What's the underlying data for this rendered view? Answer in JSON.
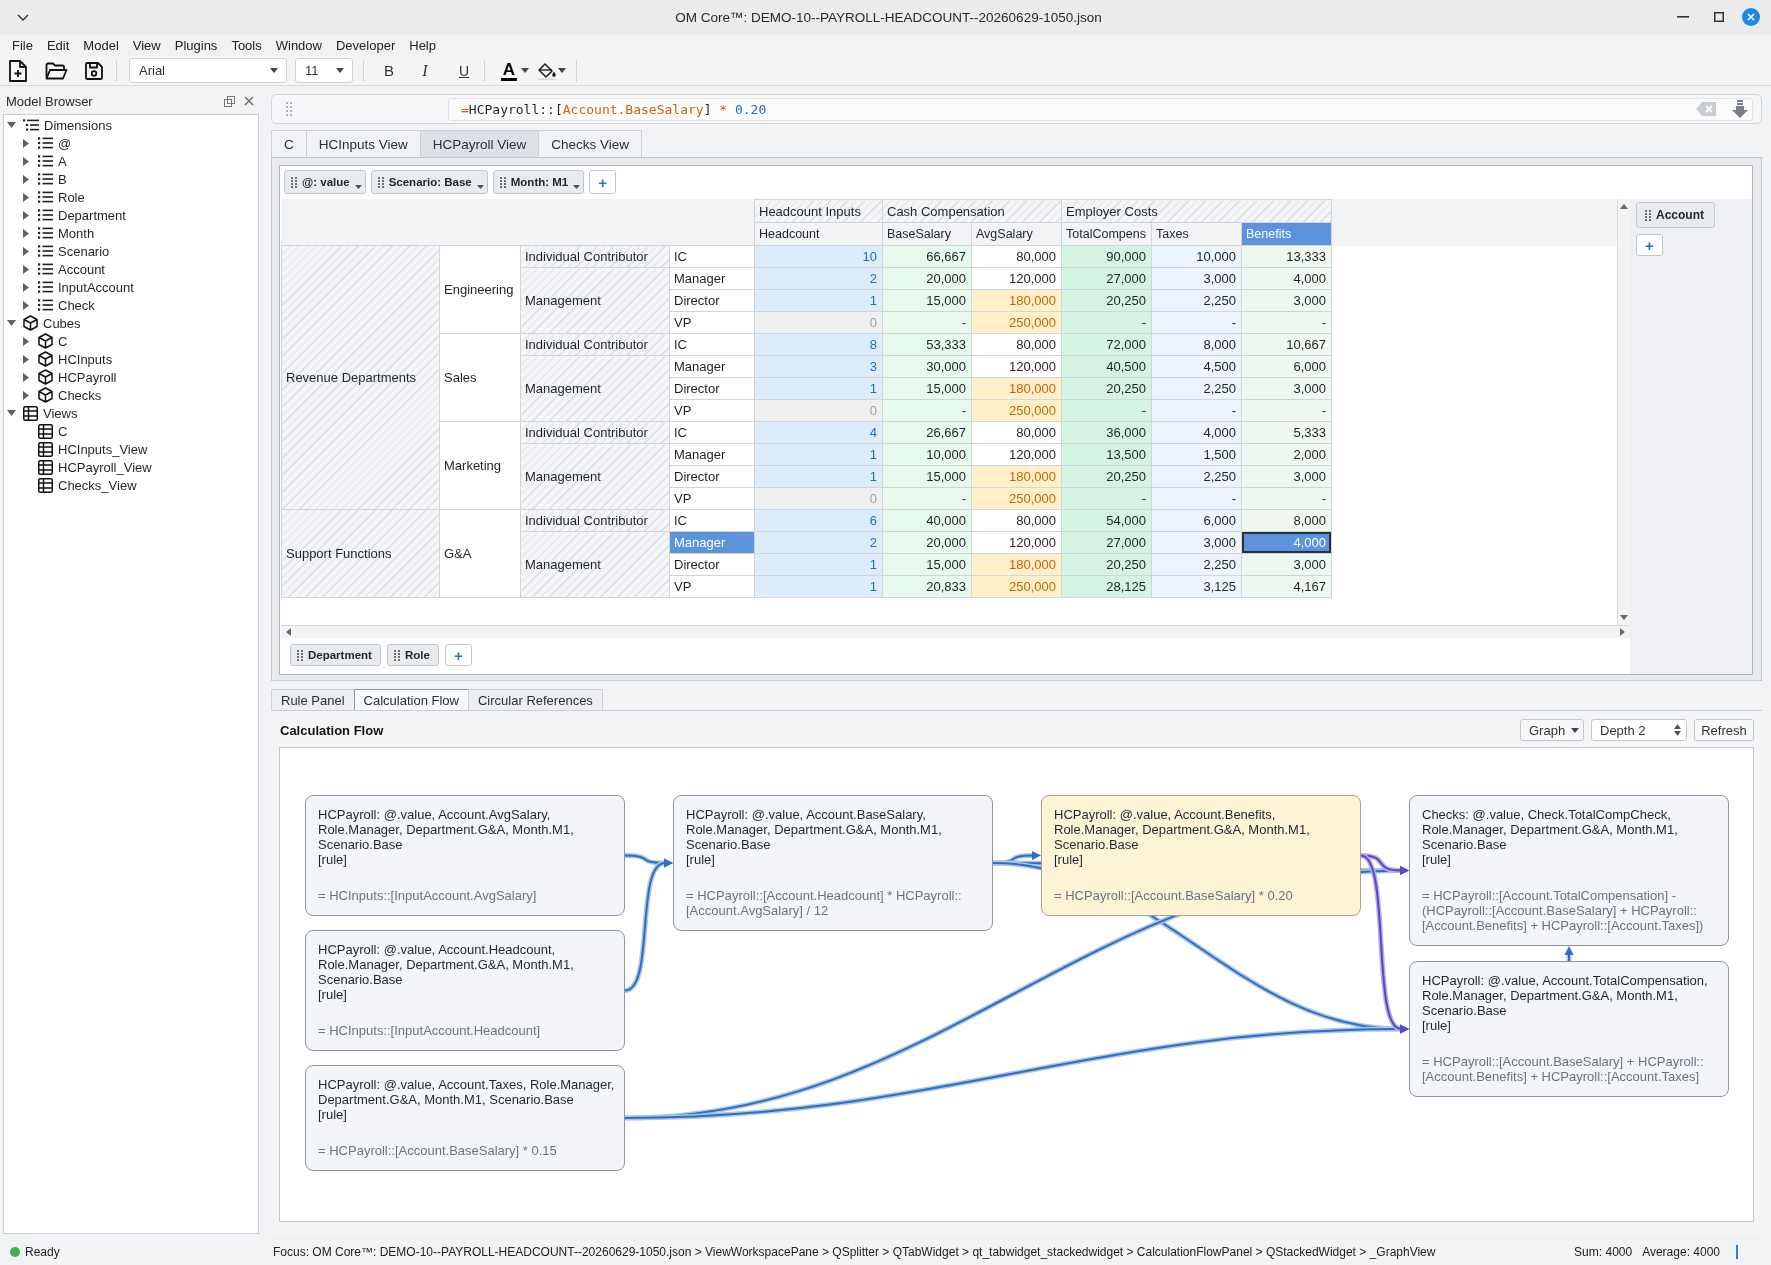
{
  "window": {
    "title": "OM Core™: DEMO-10--PAYROLL-HEADCOUNT--20260629-1050.json"
  },
  "menu": [
    "File",
    "Edit",
    "Model",
    "View",
    "Plugins",
    "Tools",
    "Window",
    "Developer",
    "Help"
  ],
  "toolbar": {
    "font": "Arial",
    "size": "11",
    "bold": "B",
    "italic": "I",
    "underline": "U",
    "text_color": "A"
  },
  "sidebar": {
    "title": "Model Browser",
    "items": [
      {
        "label": "Dimensions",
        "kind": "dimension_group",
        "expanded": true,
        "children": [
          {
            "label": "@",
            "kind": "dimension",
            "expanded": false
          },
          {
            "label": "A",
            "kind": "dimension",
            "expanded": false
          },
          {
            "label": "B",
            "kind": "dimension",
            "expanded": false
          },
          {
            "label": "Role",
            "kind": "dimension",
            "expanded": false
          },
          {
            "label": "Department",
            "kind": "dimension",
            "expanded": false
          },
          {
            "label": "Month",
            "kind": "dimension",
            "expanded": false
          },
          {
            "label": "Scenario",
            "kind": "dimension",
            "expanded": false
          },
          {
            "label": "Account",
            "kind": "dimension",
            "expanded": false
          },
          {
            "label": "InputAccount",
            "kind": "dimension",
            "expanded": false
          },
          {
            "label": "Check",
            "kind": "dimension",
            "expanded": false
          }
        ]
      },
      {
        "label": "Cubes",
        "kind": "cube",
        "expanded": true,
        "children": [
          {
            "label": "C",
            "kind": "cube",
            "expanded": false
          },
          {
            "label": "HCInputs",
            "kind": "cube",
            "expanded": false
          },
          {
            "label": "HCPayroll",
            "kind": "cube",
            "expanded": false
          },
          {
            "label": "Checks",
            "kind": "cube",
            "expanded": false
          }
        ]
      },
      {
        "label": "Views",
        "kind": "view",
        "expanded": true,
        "children": [
          {
            "label": "C",
            "kind": "view"
          },
          {
            "label": "HCInputs_View",
            "kind": "view"
          },
          {
            "label": "HCPayroll_View",
            "kind": "view"
          },
          {
            "label": "Checks_View",
            "kind": "view"
          }
        ]
      }
    ]
  },
  "formula_bar": {
    "tokens": [
      {
        "text": "=",
        "kind": "operator"
      },
      {
        "text": "HCPayroll::[",
        "kind": "plain"
      },
      {
        "text": "Account.BaseSalary",
        "kind": "reference"
      },
      {
        "text": "] ",
        "kind": "plain"
      },
      {
        "text": "* ",
        "kind": "operator"
      },
      {
        "text": "0.20",
        "kind": "number"
      }
    ]
  },
  "view_tabs": [
    {
      "label": "C",
      "selected": false
    },
    {
      "label": "HCInputs View",
      "selected": false
    },
    {
      "label": "HCPayroll View",
      "selected": true
    },
    {
      "label": "Checks View",
      "selected": false
    }
  ],
  "pivot": {
    "filters": {
      "items": [
        "@: value",
        "Scenario: Base",
        "Month: M1"
      ],
      "add": "+"
    },
    "column_groups": [
      {
        "label": "Headcount Inputs",
        "columns": [
          {
            "label": "Headcount",
            "selected": false
          }
        ]
      },
      {
        "label": "Cash Compensation",
        "columns": [
          {
            "label": "BaseSalary",
            "selected": false
          },
          {
            "label": "AvgSalary",
            "selected": false
          }
        ]
      },
      {
        "label": "Employer Costs",
        "columns": [
          {
            "label": "TotalCompens",
            "selected": false
          },
          {
            "label": "Taxes",
            "selected": false
          },
          {
            "label": "Benefits",
            "selected": true
          }
        ]
      }
    ],
    "rows": [
      {
        "label": "Revenue Departments",
        "hatched": true,
        "children": [
          {
            "label": "Engineering",
            "hatched": false,
            "children": [
              {
                "label": "Individual Contributor",
                "hatched": true,
                "children": [
                  {
                    "label": "IC",
                    "selected": false,
                    "cells": [
                      {
                        "value": "10",
                        "kind": "input",
                        "selected": false
                      },
                      {
                        "value": "66,667",
                        "kind": "calc",
                        "selected": false
                      },
                      {
                        "value": "80,000",
                        "kind": "calc",
                        "selected": false
                      },
                      {
                        "value": "90,000",
                        "kind": "calc",
                        "selected": false
                      },
                      {
                        "value": "10,000",
                        "kind": "calc",
                        "selected": false
                      },
                      {
                        "value": "13,333",
                        "kind": "calc",
                        "selected": false
                      }
                    ]
                  }
                ]
              },
              {
                "label": "Management",
                "hatched": true,
                "children": [
                  {
                    "label": "Manager",
                    "selected": false,
                    "cells": [
                      {
                        "value": "2",
                        "kind": "input",
                        "selected": false
                      },
                      {
                        "value": "20,000",
                        "kind": "calc",
                        "selected": false
                      },
                      {
                        "value": "120,000",
                        "kind": "calc",
                        "selected": false
                      },
                      {
                        "value": "27,000",
                        "kind": "calc",
                        "selected": false
                      },
                      {
                        "value": "3,000",
                        "kind": "calc",
                        "selected": false
                      },
                      {
                        "value": "4,000",
                        "kind": "calc",
                        "selected": false
                      }
                    ]
                  },
                  {
                    "label": "Director",
                    "selected": false,
                    "cells": [
                      {
                        "value": "1",
                        "kind": "input",
                        "selected": false
                      },
                      {
                        "value": "15,000",
                        "kind": "calc",
                        "selected": false
                      },
                      {
                        "value": "180,000",
                        "kind": "flag",
                        "selected": false
                      },
                      {
                        "value": "20,250",
                        "kind": "calc",
                        "selected": false
                      },
                      {
                        "value": "2,250",
                        "kind": "calc",
                        "selected": false
                      },
                      {
                        "value": "3,000",
                        "kind": "calc",
                        "selected": false
                      }
                    ]
                  },
                  {
                    "label": "VP",
                    "selected": false,
                    "cells": [
                      {
                        "value": "0",
                        "kind": "zero",
                        "selected": false
                      },
                      {
                        "value": "-",
                        "kind": "calc",
                        "selected": false
                      },
                      {
                        "value": "250,000",
                        "kind": "flag",
                        "selected": false
                      },
                      {
                        "value": "-",
                        "kind": "calc",
                        "selected": false
                      },
                      {
                        "value": "-",
                        "kind": "calc",
                        "selected": false
                      },
                      {
                        "value": "-",
                        "kind": "calc",
                        "selected": false
                      }
                    ]
                  }
                ]
              }
            ]
          },
          {
            "label": "Sales",
            "hatched": false,
            "children": [
              {
                "label": "Individual Contributor",
                "hatched": true,
                "children": [
                  {
                    "label": "IC",
                    "selected": false,
                    "cells": [
                      {
                        "value": "8",
                        "kind": "input",
                        "selected": false
                      },
                      {
                        "value": "53,333",
                        "kind": "calc",
                        "selected": false
                      },
                      {
                        "value": "80,000",
                        "kind": "calc",
                        "selected": false
                      },
                      {
                        "value": "72,000",
                        "kind": "calc",
                        "selected": false
                      },
                      {
                        "value": "8,000",
                        "kind": "calc",
                        "selected": false
                      },
                      {
                        "value": "10,667",
                        "kind": "calc",
                        "selected": false
                      }
                    ]
                  }
                ]
              },
              {
                "label": "Management",
                "hatched": true,
                "children": [
                  {
                    "label": "Manager",
                    "selected": false,
                    "cells": [
                      {
                        "value": "3",
                        "kind": "input",
                        "selected": false
                      },
                      {
                        "value": "30,000",
                        "kind": "calc",
                        "selected": false
                      },
                      {
                        "value": "120,000",
                        "kind": "calc",
                        "selected": false
                      },
                      {
                        "value": "40,500",
                        "kind": "calc",
                        "selected": false
                      },
                      {
                        "value": "4,500",
                        "kind": "calc",
                        "selected": false
                      },
                      {
                        "value": "6,000",
                        "kind": "calc",
                        "selected": false
                      }
                    ]
                  },
                  {
                    "label": "Director",
                    "selected": false,
                    "cells": [
                      {
                        "value": "1",
                        "kind": "input",
                        "selected": false
                      },
                      {
                        "value": "15,000",
                        "kind": "calc",
                        "selected": false
                      },
                      {
                        "value": "180,000",
                        "kind": "flag",
                        "selected": false
                      },
                      {
                        "value": "20,250",
                        "kind": "calc",
                        "selected": false
                      },
                      {
                        "value": "2,250",
                        "kind": "calc",
                        "selected": false
                      },
                      {
                        "value": "3,000",
                        "kind": "calc",
                        "selected": false
                      }
                    ]
                  },
                  {
                    "label": "VP",
                    "selected": false,
                    "cells": [
                      {
                        "value": "0",
                        "kind": "zero",
                        "selected": false
                      },
                      {
                        "value": "-",
                        "kind": "calc",
                        "selected": false
                      },
                      {
                        "value": "250,000",
                        "kind": "flag",
                        "selected": false
                      },
                      {
                        "value": "-",
                        "kind": "calc",
                        "selected": false
                      },
                      {
                        "value": "-",
                        "kind": "calc",
                        "selected": false
                      },
                      {
                        "value": "-",
                        "kind": "calc",
                        "selected": false
                      }
                    ]
                  }
                ]
              }
            ]
          },
          {
            "label": "Marketing",
            "hatched": false,
            "children": [
              {
                "label": "Individual Contributor",
                "hatched": true,
                "children": [
                  {
                    "label": "IC",
                    "selected": false,
                    "cells": [
                      {
                        "value": "4",
                        "kind": "input",
                        "selected": false
                      },
                      {
                        "value": "26,667",
                        "kind": "calc",
                        "selected": false
                      },
                      {
                        "value": "80,000",
                        "kind": "calc",
                        "selected": false
                      },
                      {
                        "value": "36,000",
                        "kind": "calc",
                        "selected": false
                      },
                      {
                        "value": "4,000",
                        "kind": "calc",
                        "selected": false
                      },
                      {
                        "value": "5,333",
                        "kind": "calc",
                        "selected": false
                      }
                    ]
                  }
                ]
              },
              {
                "label": "Management",
                "hatched": true,
                "children": [
                  {
                    "label": "Manager",
                    "selected": false,
                    "cells": [
                      {
                        "value": "1",
                        "kind": "input",
                        "selected": false
                      },
                      {
                        "value": "10,000",
                        "kind": "calc",
                        "selected": false
                      },
                      {
                        "value": "120,000",
                        "kind": "calc",
                        "selected": false
                      },
                      {
                        "value": "13,500",
                        "kind": "calc",
                        "selected": false
                      },
                      {
                        "value": "1,500",
                        "kind": "calc",
                        "selected": false
                      },
                      {
                        "value": "2,000",
                        "kind": "calc",
                        "selected": false
                      }
                    ]
                  },
                  {
                    "label": "Director",
                    "selected": false,
                    "cells": [
                      {
                        "value": "1",
                        "kind": "input",
                        "selected": false
                      },
                      {
                        "value": "15,000",
                        "kind": "calc",
                        "selected": false
                      },
                      {
                        "value": "180,000",
                        "kind": "flag",
                        "selected": false
                      },
                      {
                        "value": "20,250",
                        "kind": "calc",
                        "selected": false
                      },
                      {
                        "value": "2,250",
                        "kind": "calc",
                        "selected": false
                      },
                      {
                        "value": "3,000",
                        "kind": "calc",
                        "selected": false
                      }
                    ]
                  },
                  {
                    "label": "VP",
                    "selected": false,
                    "cells": [
                      {
                        "value": "0",
                        "kind": "zero",
                        "selected": false
                      },
                      {
                        "value": "-",
                        "kind": "calc",
                        "selected": false
                      },
                      {
                        "value": "250,000",
                        "kind": "flag",
                        "selected": false
                      },
                      {
                        "value": "-",
                        "kind": "calc",
                        "selected": false
                      },
                      {
                        "value": "-",
                        "kind": "calc",
                        "selected": false
                      },
                      {
                        "value": "-",
                        "kind": "calc",
                        "selected": false
                      }
                    ]
                  }
                ]
              }
            ]
          }
        ]
      },
      {
        "label": "Support Functions",
        "hatched": true,
        "children": [
          {
            "label": "G&A",
            "hatched": false,
            "children": [
              {
                "label": "Individual Contributor",
                "hatched": true,
                "children": [
                  {
                    "label": "IC",
                    "selected": false,
                    "cells": [
                      {
                        "value": "6",
                        "kind": "input",
                        "selected": false
                      },
                      {
                        "value": "40,000",
                        "kind": "calc",
                        "selected": false
                      },
                      {
                        "value": "80,000",
                        "kind": "calc",
                        "selected": false
                      },
                      {
                        "value": "54,000",
                        "kind": "calc",
                        "selected": false
                      },
                      {
                        "value": "6,000",
                        "kind": "calc",
                        "selected": false
                      },
                      {
                        "value": "8,000",
                        "kind": "calc",
                        "selected": false
                      }
                    ]
                  }
                ]
              },
              {
                "label": "Management",
                "hatched": true,
                "children": [
                  {
                    "label": "Manager",
                    "selected": true,
                    "cells": [
                      {
                        "value": "2",
                        "kind": "input",
                        "selected": false
                      },
                      {
                        "value": "20,000",
                        "kind": "calc",
                        "selected": false
                      },
                      {
                        "value": "120,000",
                        "kind": "calc",
                        "selected": false
                      },
                      {
                        "value": "27,000",
                        "kind": "calc",
                        "selected": false
                      },
                      {
                        "value": "3,000",
                        "kind": "calc",
                        "selected": false
                      },
                      {
                        "value": "4,000",
                        "kind": "calc",
                        "selected": true
                      }
                    ]
                  },
                  {
                    "label": "Director",
                    "selected": false,
                    "cells": [
                      {
                        "value": "1",
                        "kind": "input",
                        "selected": false
                      },
                      {
                        "value": "15,000",
                        "kind": "calc",
                        "selected": false
                      },
                      {
                        "value": "180,000",
                        "kind": "flag",
                        "selected": false
                      },
                      {
                        "value": "20,250",
                        "kind": "calc",
                        "selected": false
                      },
                      {
                        "value": "2,250",
                        "kind": "calc",
                        "selected": false
                      },
                      {
                        "value": "3,000",
                        "kind": "calc",
                        "selected": false
                      }
                    ]
                  },
                  {
                    "label": "VP",
                    "selected": false,
                    "cells": [
                      {
                        "value": "1",
                        "kind": "input",
                        "selected": false
                      },
                      {
                        "value": "20,833",
                        "kind": "calc",
                        "selected": false
                      },
                      {
                        "value": "250,000",
                        "kind": "flag",
                        "selected": false
                      },
                      {
                        "value": "28,125",
                        "kind": "calc",
                        "selected": false
                      },
                      {
                        "value": "3,125",
                        "kind": "calc",
                        "selected": false
                      },
                      {
                        "value": "4,167",
                        "kind": "calc",
                        "selected": false
                      }
                    ]
                  }
                ]
              }
            ]
          }
        ]
      }
    ],
    "row_dimensions": {
      "items": [
        "Department",
        "Role"
      ],
      "add": "+"
    },
    "column_dimensions": {
      "items": [
        "Account"
      ],
      "add": "+"
    }
  },
  "bottom_tabs": [
    {
      "label": "Rule Panel",
      "selected": false
    },
    {
      "label": "Calculation Flow",
      "selected": true
    },
    {
      "label": "Circular References",
      "selected": false
    }
  ],
  "calculation_flow": {
    "title": "Calculation Flow",
    "mode": "Graph",
    "depth": "Depth 2",
    "refresh": "Refresh",
    "nodes": [
      {
        "context": "HCPayroll: @.value, Account.AvgSalary, Role.Manager, Department.G&A, Month.M1, Scenario.Base",
        "tag": "[rule]",
        "formula": "= HCInputs::[InputAccount.AvgSalary]",
        "selected": false
      },
      {
        "context": "HCPayroll: @.value, Account.Headcount, Role.Manager, Department.G&A, Month.M1, Scenario.Base",
        "tag": "[rule]",
        "formula": "= HCInputs::[InputAccount.Headcount]",
        "selected": false
      },
      {
        "context": "HCPayroll: @.value, Account.Taxes, Role.Manager, Department.G&A, Month.M1, Scenario.Base",
        "tag": "[rule]",
        "formula": "= HCPayroll::[Account.BaseSalary] * 0.15",
        "selected": false
      },
      {
        "context": "HCPayroll: @.value, Account.BaseSalary, Role.Manager, Department.G&A, Month.M1, Scenario.Base",
        "tag": "[rule]",
        "formula": "= HCPayroll::[Account.Headcount] * HCPayroll::[Account.AvgSalary] / 12",
        "selected": false
      },
      {
        "context": "HCPayroll: @.value, Account.Benefits, Role.Manager, Department.G&A, Month.M1, Scenario.Base",
        "tag": "[rule]",
        "formula": "= HCPayroll::[Account.BaseSalary] * 0.20",
        "selected": true
      },
      {
        "context": "Checks: @.value, Check.TotalCompCheck, Role.Manager, Department.G&A, Month.M1, Scenario.Base",
        "tag": "[rule]",
        "formula": "= HCPayroll::[Account.TotalCompensation] - (HCPayroll::[Account.BaseSalary] + HCPayroll::[Account.Benefits] + HCPayroll::[Account.Taxes])",
        "selected": false
      },
      {
        "context": "HCPayroll: @.value, Account.TotalCompensation, Role.Manager, Department.G&A, Month.M1, Scenario.Base",
        "tag": "[rule]",
        "formula": "= HCPayroll::[Account.BaseSalary] + HCPayroll::[Account.Benefits] + HCPayroll::[Account.Taxes]",
        "selected": false
      }
    ]
  },
  "status_bar": {
    "state": "Ready",
    "focus": "Focus: OM Core™: DEMO-10--PAYROLL-HEADCOUNT--20260629-1050.json > ViewWorkspacePane > QSplitter > QTabWidget > qt_tabwidget_stackedwidget > CalculationFlowPanel > QStackedWidget > _GraphView",
    "sum": "Sum: 4000",
    "average": "Average: 4000"
  }
}
